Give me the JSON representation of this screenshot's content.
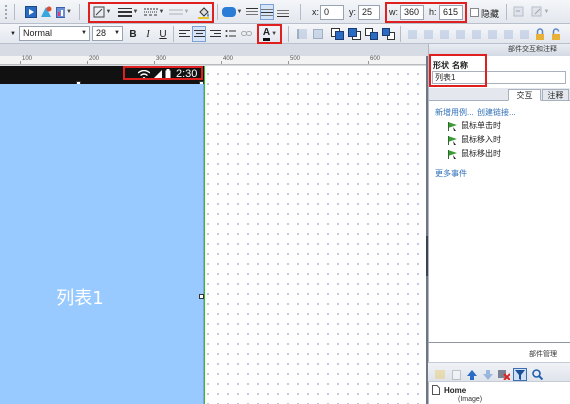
{
  "toolbar_top": {
    "x_label": "x:",
    "x_value": "0",
    "y_label": "y:",
    "y_value": "25",
    "w_label": "w:",
    "w_value": "360",
    "h_label": "h:",
    "h_value": "615",
    "hide_label": "隐藏"
  },
  "toolbar_format": {
    "font_style": "Normal",
    "font_size": "28",
    "bold": "B",
    "italic": "I",
    "underline": "U",
    "font_color_glyph": "A"
  },
  "ruler": {
    "ticks": [
      "100",
      "200",
      "300",
      "400",
      "500",
      "600"
    ]
  },
  "device": {
    "time": "2:30"
  },
  "canvas": {
    "list_label": "列表1"
  },
  "interaction_panel": {
    "title": "部件交互和注释",
    "shape_label": "形状",
    "name_label": "名称",
    "name_value": "列表1",
    "tab_interaction": "交互",
    "tab_notes": "注释",
    "new_use_case": "新增用例...",
    "create_link": "创建链接...",
    "events": [
      "鼠标单击时",
      "鼠标移入时",
      "鼠标移出时"
    ],
    "more_events": "更多事件"
  },
  "widget_manager": {
    "title": "部件管理",
    "tree": [
      {
        "label": "Home"
      },
      {
        "label": "(Image)"
      }
    ]
  },
  "colors": {
    "highlight": "#e0201e",
    "list_fill": "#99caff",
    "status_bar": "#111111",
    "link": "#2f6fb8"
  }
}
